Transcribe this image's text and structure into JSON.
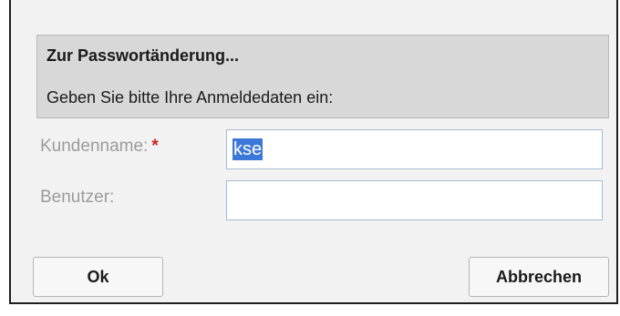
{
  "dialog": {
    "header": {
      "title": "Zur Passwortänderung...",
      "subtitle": "Geben Sie bitte Ihre Anmeldedaten ein:"
    },
    "fields": [
      {
        "label": "Kundenname:",
        "required_marker": "*",
        "value": "kse",
        "selected": true
      },
      {
        "label": "Benutzer:",
        "value": ""
      }
    ],
    "buttons": {
      "ok_label": "Ok",
      "cancel_label": "Abbrechen"
    }
  },
  "colors": {
    "header_bg": "#d8d8d8",
    "label_text": "#9b9b9b",
    "required_star": "#cc2222",
    "selection_bg": "#3b78d8",
    "input_border": "#a9b9d4"
  }
}
